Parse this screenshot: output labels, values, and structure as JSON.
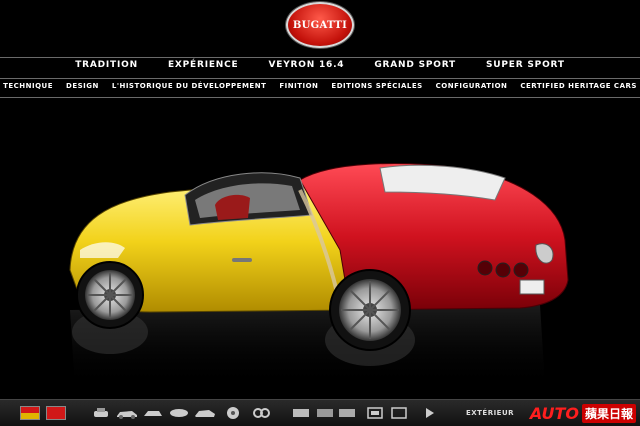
{
  "brand": {
    "logo_text": "BUGATTI"
  },
  "primary_nav": [
    "TRADITION",
    "EXPÉRIENCE",
    "VEYRON 16.4",
    "GRAND SPORT",
    "SUPER SPORT"
  ],
  "secondary_nav": [
    "TECHNIQUE",
    "DESIGN",
    "L'HISTORIQUE DU DÉVELOPPEMENT",
    "FINITION",
    "EDITIONS SPÉCIALES",
    "CONFIGURATION",
    "CERTIFIED HERITAGE CARS"
  ],
  "toolbar": {
    "swatch_colors": [
      "#d11818",
      "#e0b600"
    ],
    "view_label": "EXTÉRIEUR",
    "icons": [
      "car-front-view-icon",
      "car-side-view-icon",
      "car-rear-view-icon",
      "car-top-view-icon",
      "car-3q-view-icon",
      "wheel-icon",
      "interior-icon",
      "engine-icon",
      "gallery-icon",
      "fullscreen-icon",
      "screen-icon",
      "play-icon",
      "zoom-icon"
    ]
  },
  "watermark": {
    "auto": "AUTO",
    "news": "蘋果日報"
  },
  "colors": {
    "body_yellow": "#f2d21a",
    "body_red": "#d0121f",
    "background": "#000000"
  }
}
